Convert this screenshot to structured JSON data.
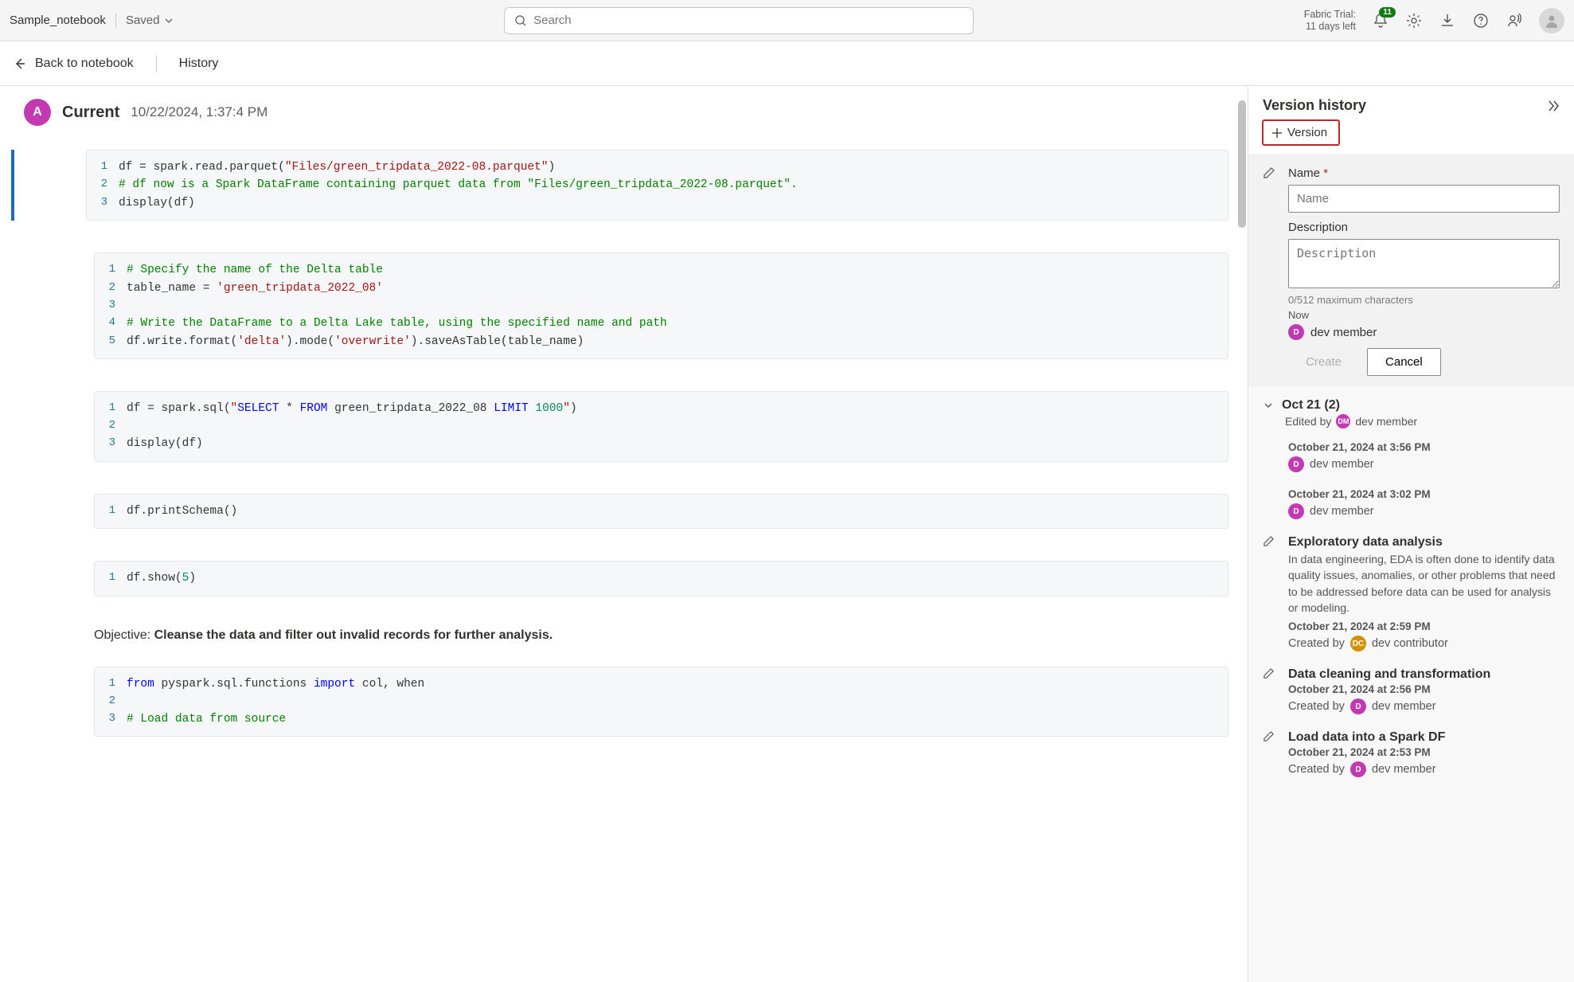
{
  "topbar": {
    "doc_name": "Sample_notebook",
    "saved_label": "Saved",
    "search_placeholder": "Search",
    "trial_line1": "Fabric Trial:",
    "trial_line2": "11 days left",
    "notif_count": "11"
  },
  "breadcrumb": {
    "back_label": "Back to notebook",
    "history_label": "History"
  },
  "content": {
    "avatar_initial": "A",
    "current_label": "Current",
    "timestamp": "10/22/2024, 1:37:4 PM",
    "cell1": {
      "ln1_a": "df = spark.read.parquet(",
      "ln1_b": "\"Files/green_tripdata_2022-08.parquet\"",
      "ln1_c": ")",
      "ln2": "# df now is a Spark DataFrame containing parquet data from \"Files/green_tripdata_2022-08.parquet\".",
      "ln3": "display(df)"
    },
    "cell2": {
      "ln1": "# Specify the name of the Delta table",
      "ln2_a": "table_name = ",
      "ln2_b": "'green_tripdata_2022_08'",
      "ln4": "# Write the DataFrame to a Delta Lake table, using the specified name and path",
      "ln5_a": "df.write.format(",
      "ln5_b": "'delta'",
      "ln5_c": ").mode(",
      "ln5_d": "'overwrite'",
      "ln5_e": ").saveAsTable(table_name)"
    },
    "cell3": {
      "ln1_a": "df = spark.sql(",
      "ln1_b": "\"",
      "ln1_c": "SELECT",
      "ln1_d": " * ",
      "ln1_e": "FROM",
      "ln1_f": " green_tripdata_2022_08 ",
      "ln1_g": "LIMIT",
      "ln1_h": " 1000",
      "ln1_i": "\"",
      "ln1_j": ")",
      "ln3": "display(df)"
    },
    "cell4": {
      "ln1": "df.printSchema()"
    },
    "cell5": {
      "ln1_a": "df.show(",
      "ln1_b": "5",
      "ln1_c": ")"
    },
    "md_objective_label": "Objective: ",
    "md_objective_text": "Cleanse the data and filter out invalid records for further analysis.",
    "cell6": {
      "ln1_a": "from",
      "ln1_b": " pyspark.sql.functions ",
      "ln1_c": "import",
      "ln1_d": " col, when",
      "ln3": "# Load data from source"
    }
  },
  "panel": {
    "title": "Version history",
    "version_btn": "Version",
    "name_label": "Name",
    "name_placeholder": "Name",
    "desc_label": "Description",
    "desc_placeholder": "Description",
    "char_counter": "0/512 maximum characters",
    "now_label": "Now",
    "user_badge": "D",
    "user_name": "dev member",
    "create_btn": "Create",
    "cancel_btn": "Cancel",
    "group": {
      "title": "Oct 21 (2)",
      "edited_by": "Edited by",
      "editor_badge": "DM",
      "editor_name": "dev member"
    },
    "items": [
      {
        "ts": "October 21, 2024 at 3:56 PM",
        "badge": "D",
        "user": "dev member"
      },
      {
        "ts": "October 21, 2024 at 3:02 PM",
        "badge": "D",
        "user": "dev member"
      }
    ],
    "named": [
      {
        "title": "Exploratory data analysis",
        "desc": "In data engineering, EDA is often done to identify data quality issues, anomalies, or other problems that need to be addressed before data can be used for analysis or modeling.",
        "ts": "October 21, 2024 at 2:59 PM",
        "by_label": "Created by",
        "badge": "DC",
        "user": "dev contributor",
        "badge_class": "c"
      },
      {
        "title": "Data cleaning and transformation",
        "desc": "",
        "ts": "October 21, 2024 at 2:56 PM",
        "by_label": "Created by",
        "badge": "D",
        "user": "dev member",
        "badge_class": "m"
      },
      {
        "title": "Load data into a Spark DF",
        "desc": "",
        "ts": "October 21, 2024 at 2:53 PM",
        "by_label": "Created by",
        "badge": "D",
        "user": "dev member",
        "badge_class": "m"
      }
    ]
  }
}
